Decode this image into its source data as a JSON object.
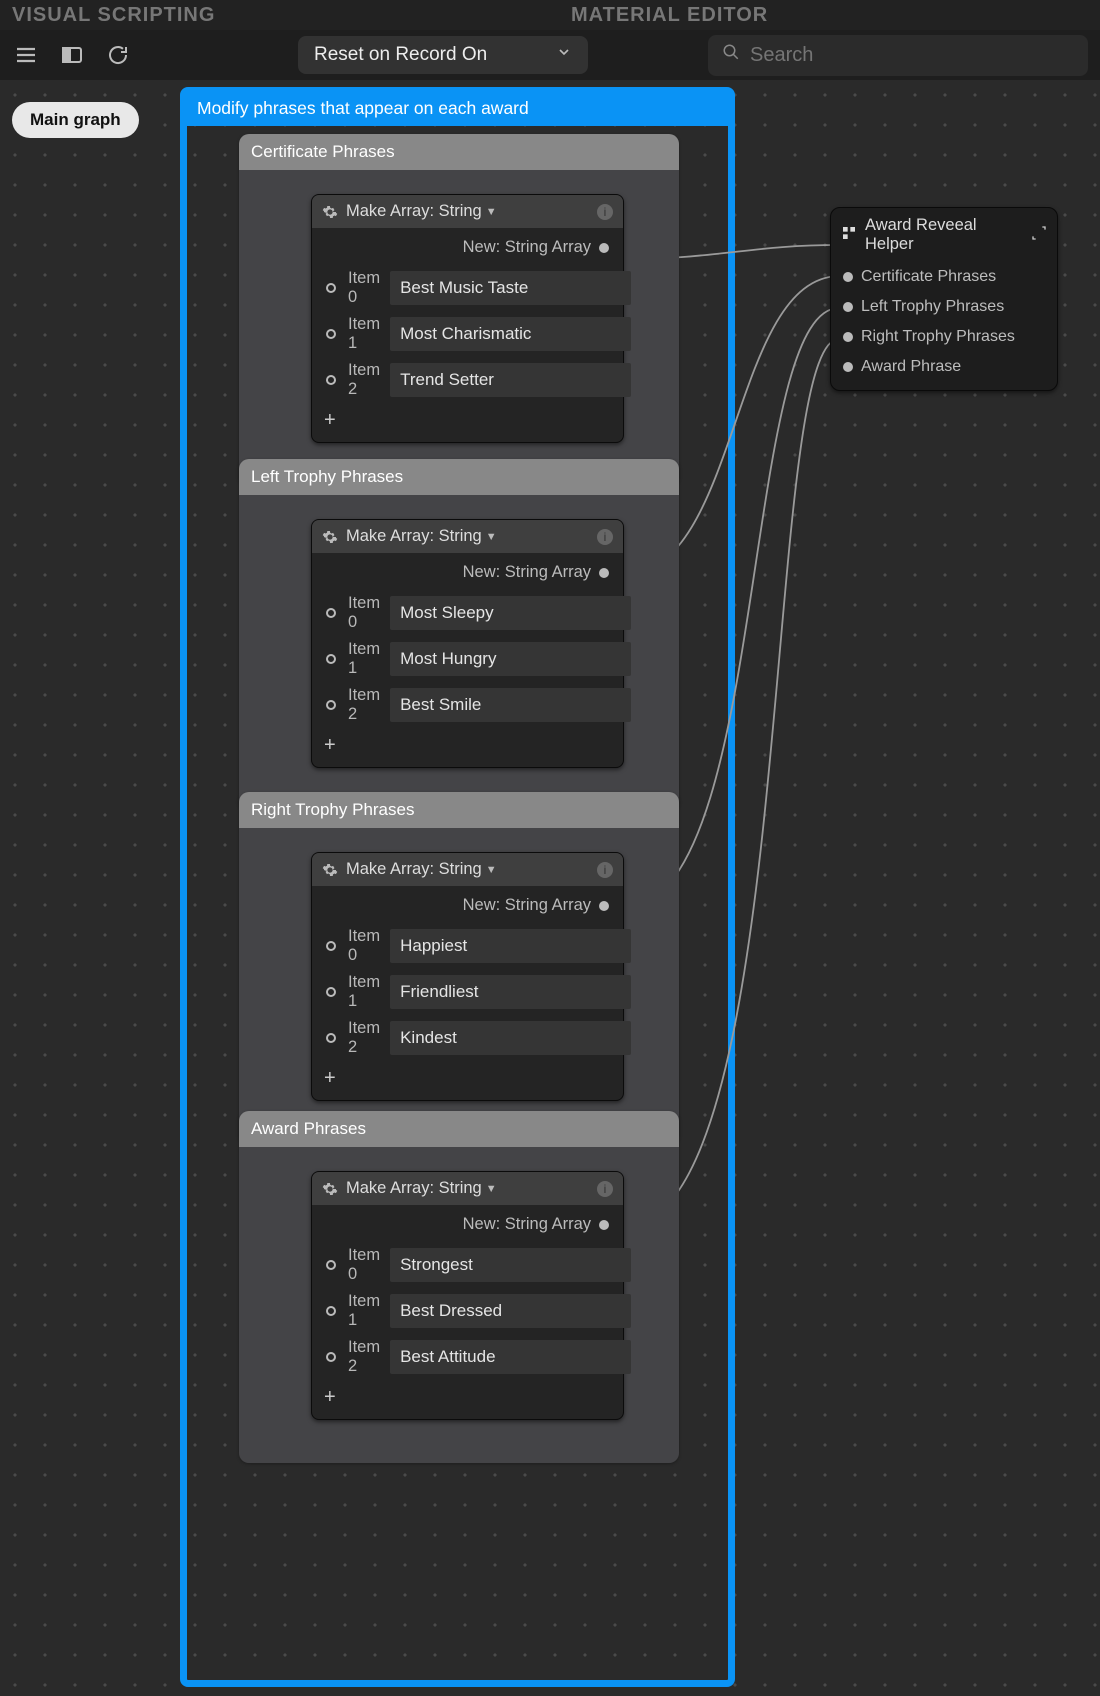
{
  "top_tabs": {
    "left": "VISUAL SCRIPTING",
    "right": "MATERIAL EDITOR"
  },
  "toolbar": {
    "reset_label": "Reset on Record On",
    "search_placeholder": "Search"
  },
  "graph_tab": "Main graph",
  "comment_title": "Modify phrases that appear on each award",
  "groups": [
    {
      "title": "Certificate Phrases",
      "make_array": {
        "label": "Make Array:",
        "type": "String",
        "output": "New: String Array"
      },
      "items": [
        {
          "label": "Item 0",
          "value": "Best Music Taste"
        },
        {
          "label": "Item 1",
          "value": "Most Charismatic"
        },
        {
          "label": "Item 2",
          "value": "Trend Setter"
        }
      ]
    },
    {
      "title": "Left Trophy Phrases",
      "make_array": {
        "label": "Make Array:",
        "type": "String",
        "output": "New: String Array"
      },
      "items": [
        {
          "label": "Item 0",
          "value": "Most Sleepy"
        },
        {
          "label": "Item 1",
          "value": "Most Hungry"
        },
        {
          "label": "Item 2",
          "value": "Best Smile"
        }
      ]
    },
    {
      "title": "Right Trophy Phrases",
      "make_array": {
        "label": "Make Array:",
        "type": "String",
        "output": "New: String Array"
      },
      "items": [
        {
          "label": "Item 0",
          "value": "Happiest"
        },
        {
          "label": "Item 1",
          "value": "Friendliest"
        },
        {
          "label": "Item 2",
          "value": "Kindest"
        }
      ]
    },
    {
      "title": "Award Phrases",
      "make_array": {
        "label": "Make Array:",
        "type": "String",
        "output": "New: String Array"
      },
      "items": [
        {
          "label": "Item 0",
          "value": "Strongest"
        },
        {
          "label": "Item 1",
          "value": "Best Dressed"
        },
        {
          "label": "Item 2",
          "value": "Best Attitude"
        }
      ]
    }
  ],
  "helper": {
    "title": "Award Reveeal Helper",
    "inputs": [
      "Certificate Phrases",
      "Left Trophy Phrases",
      "Right Trophy Phrases",
      "Award Phrase"
    ]
  }
}
